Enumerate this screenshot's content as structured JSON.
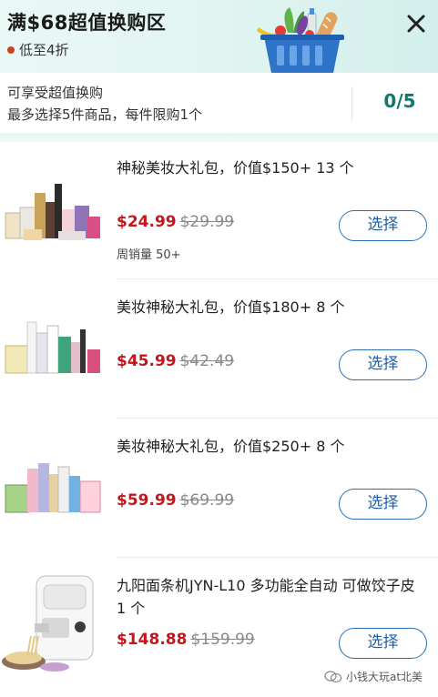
{
  "header": {
    "title": "满$68超值换购区",
    "subtitle": "低至4折",
    "accent_dot_color": "#c8461e",
    "close_icon": "close-icon",
    "illustration": "shopping-basket-with-groceries"
  },
  "info": {
    "line1": "可享受超值换购",
    "line2": "最多选择5件商品，每件限购1个",
    "counter": "0/5"
  },
  "products": [
    {
      "title": "神秘美妆大礼包，价值$150+ 13 个",
      "price": "$24.99",
      "original_price": "$29.99",
      "sales": "周销量 50+",
      "button": "选择"
    },
    {
      "title": "美妆神秘大礼包，价值$180+ 8 个",
      "price": "$45.99",
      "original_price": "$42.49",
      "sales": "",
      "button": "选择"
    },
    {
      "title": "美妆神秘大礼包，价值$250+ 8 个",
      "price": "$59.99",
      "original_price": "$69.99",
      "sales": "",
      "button": "选择"
    },
    {
      "title": "九阳面条机JYN-L10 多功能全自动 可做饺子皮 1 个",
      "price": "$148.88",
      "original_price": "$159.99",
      "sales": "",
      "button": "选择"
    }
  ],
  "watermark": "小钱大玩at北美",
  "colors": {
    "price": "#c4161c",
    "accent": "#0f7a6a",
    "button_border": "#2a6fb3"
  }
}
